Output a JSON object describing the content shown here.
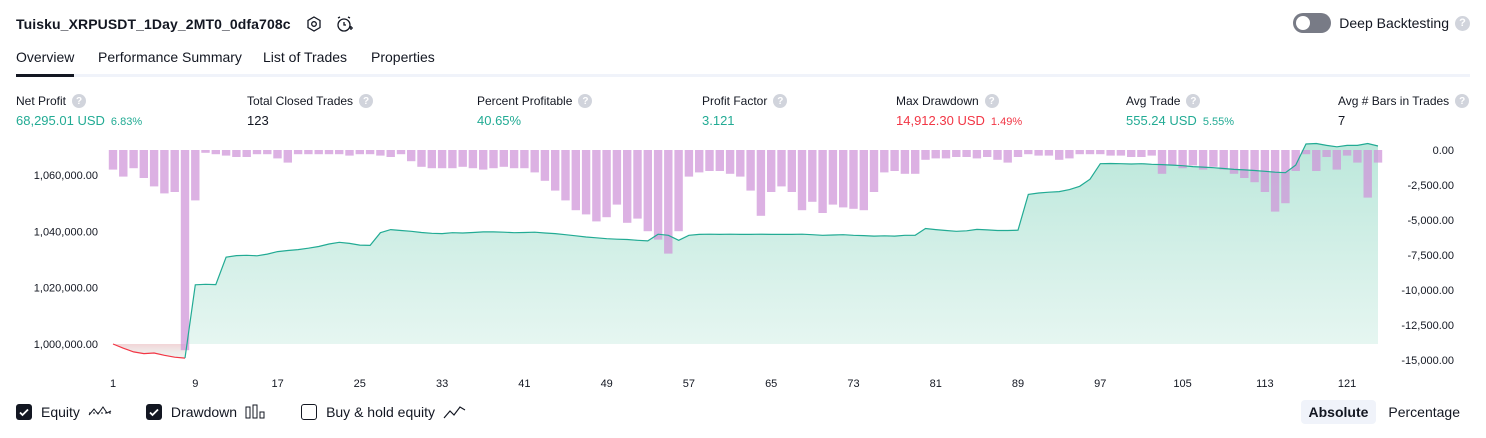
{
  "header": {
    "title": "Tuisku_XRPUSDT_1Day_2MT0_0dfa708c",
    "settings_icon": "gear-icon",
    "alert_icon": "alarm-clock-plus-icon",
    "deep_backtesting_label": "Deep Backtesting",
    "deep_backtesting_enabled": false,
    "help_glyph": "?"
  },
  "tabs": [
    {
      "label": "Overview",
      "active": true
    },
    {
      "label": "Performance Summary",
      "active": false
    },
    {
      "label": "List of Trades",
      "active": false
    },
    {
      "label": "Properties",
      "active": false
    }
  ],
  "metrics": [
    {
      "label": "Net Profit",
      "value": "68,295.01 USD",
      "pct": "6.83%",
      "tone": "green"
    },
    {
      "label": "Total Closed Trades",
      "value": "123",
      "pct": "",
      "tone": "dark"
    },
    {
      "label": "Percent Profitable",
      "value": "40.65%",
      "pct": "",
      "tone": "green"
    },
    {
      "label": "Profit Factor",
      "value": "3.121",
      "pct": "",
      "tone": "green"
    },
    {
      "label": "Max Drawdown",
      "value": "14,912.30 USD",
      "pct": "1.49%",
      "tone": "red"
    },
    {
      "label": "Avg Trade",
      "value": "555.24 USD",
      "pct": "5.55%",
      "tone": "green"
    },
    {
      "label": "Avg # Bars in Trades",
      "value": "7",
      "pct": "",
      "tone": "dark"
    }
  ],
  "chart_data": {
    "type": "area",
    "x_ticks": [
      "1",
      "9",
      "17",
      "25",
      "33",
      "41",
      "49",
      "57",
      "65",
      "73",
      "81",
      "89",
      "97",
      "105",
      "113",
      "121"
    ],
    "x_range": [
      1,
      124
    ],
    "equity_axis": {
      "ticks": [
        "1,060,000.00",
        "1,040,000.00",
        "1,020,000.00",
        "1,000,000.00"
      ],
      "tick_values": [
        1060000,
        1040000,
        1020000,
        1000000
      ],
      "range": [
        993000,
        1070000
      ]
    },
    "drawdown_axis": {
      "ticks": [
        "0.00",
        "-2,500.00",
        "-5,000.00",
        "-7,500.00",
        "-10,000.00",
        "-12,500.00",
        "-15,000.00"
      ],
      "tick_values": [
        0,
        -2500,
        -5000,
        -7500,
        -10000,
        -12500,
        -15000
      ],
      "range": [
        -15000,
        0
      ]
    },
    "colors": {
      "equity_up": "#22ab94",
      "equity_down": "#f23645",
      "drawdown": "#ce93d8",
      "fill": "#c8ebe2"
    },
    "series": [
      {
        "name": "Equity",
        "values": [
          1000000,
          998500,
          997200,
          996600,
          996800,
          996000,
          995300,
          995000,
          1021000,
          1021200,
          1021100,
          1030800,
          1031400,
          1031500,
          1031300,
          1031900,
          1032800,
          1033200,
          1033500,
          1034000,
          1034600,
          1035500,
          1036100,
          1035700,
          1035100,
          1035000,
          1039500,
          1040600,
          1040300,
          1040000,
          1039600,
          1039300,
          1039200,
          1039500,
          1039400,
          1039600,
          1039800,
          1039800,
          1039700,
          1039500,
          1039600,
          1039700,
          1039400,
          1039200,
          1038800,
          1038400,
          1038000,
          1037700,
          1037400,
          1037200,
          1037100,
          1036800,
          1036600,
          1039000,
          1038600,
          1036800,
          1038600,
          1038900,
          1039000,
          1038900,
          1039000,
          1038900,
          1038900,
          1039000,
          1038900,
          1038900,
          1038900,
          1039000,
          1038800,
          1038600,
          1038700,
          1038800,
          1038600,
          1038500,
          1038300,
          1038400,
          1038300,
          1038600,
          1038600,
          1041000,
          1040600,
          1040300,
          1040000,
          1040200,
          1040700,
          1040500,
          1040300,
          1040300,
          1040400,
          1053100,
          1053600,
          1053900,
          1054100,
          1054800,
          1056000,
          1058500,
          1064000,
          1064100,
          1064000,
          1063900,
          1064000,
          1063800,
          1063700,
          1063500,
          1063300,
          1063000,
          1062800,
          1062600,
          1062300,
          1062000,
          1061800,
          1061600,
          1061300,
          1061000,
          1060800,
          1063500,
          1071000,
          1071200,
          1070500,
          1070000,
          1070500,
          1070500,
          1071200,
          1070300
        ],
        "drawdown": [
          -1400,
          -1900,
          -1300,
          -2000,
          -2600,
          -3100,
          -3000,
          -14300,
          -3600,
          -200,
          -300,
          -400,
          -500,
          -500,
          -300,
          -300,
          -600,
          -900,
          -300,
          -300,
          -300,
          -300,
          -300,
          -400,
          -300,
          -300,
          -400,
          -500,
          -300,
          -800,
          -1200,
          -1300,
          -1300,
          -1300,
          -1200,
          -1300,
          -1400,
          -1300,
          -1200,
          -1300,
          -1300,
          -1600,
          -2200,
          -2900,
          -3600,
          -4300,
          -4600,
          -5100,
          -4800,
          -3900,
          -5200,
          -4900,
          -5800,
          -6400,
          -7400,
          -5800,
          -1900,
          -1600,
          -1500,
          -1500,
          -1700,
          -1900,
          -2900,
          -4700,
          -3000,
          -2600,
          -3000,
          -4300,
          -3700,
          -4500,
          -3900,
          -4100,
          -4200,
          -4300,
          -3000,
          -1600,
          -1500,
          -1700,
          -1700,
          -700,
          -600,
          -600,
          -500,
          -500,
          -600,
          -500,
          -700,
          -900,
          -500,
          -300,
          -400,
          -400,
          -700,
          -600,
          -300,
          -300,
          -300,
          -400,
          -400,
          -500,
          -500,
          -400,
          -1700,
          -1100,
          -1300,
          -1100,
          -1400,
          -1200,
          -1400,
          -1700,
          -2000,
          -2300,
          -3000,
          -4400,
          -3800,
          -1500,
          -300,
          -1500,
          -500,
          -1400,
          -400,
          -900,
          -3400,
          -900
        ]
      }
    ],
    "legend": [
      {
        "label": "Equity",
        "checked": true,
        "icon": "equity-line-icon"
      },
      {
        "label": "Drawdown",
        "checked": true,
        "icon": "drawdown-bars-icon"
      },
      {
        "label": "Buy & hold equity",
        "checked": false,
        "icon": "buy-hold-line-icon"
      }
    ]
  },
  "view_mode": {
    "options": [
      "Absolute",
      "Percentage"
    ],
    "selected": "Absolute"
  }
}
